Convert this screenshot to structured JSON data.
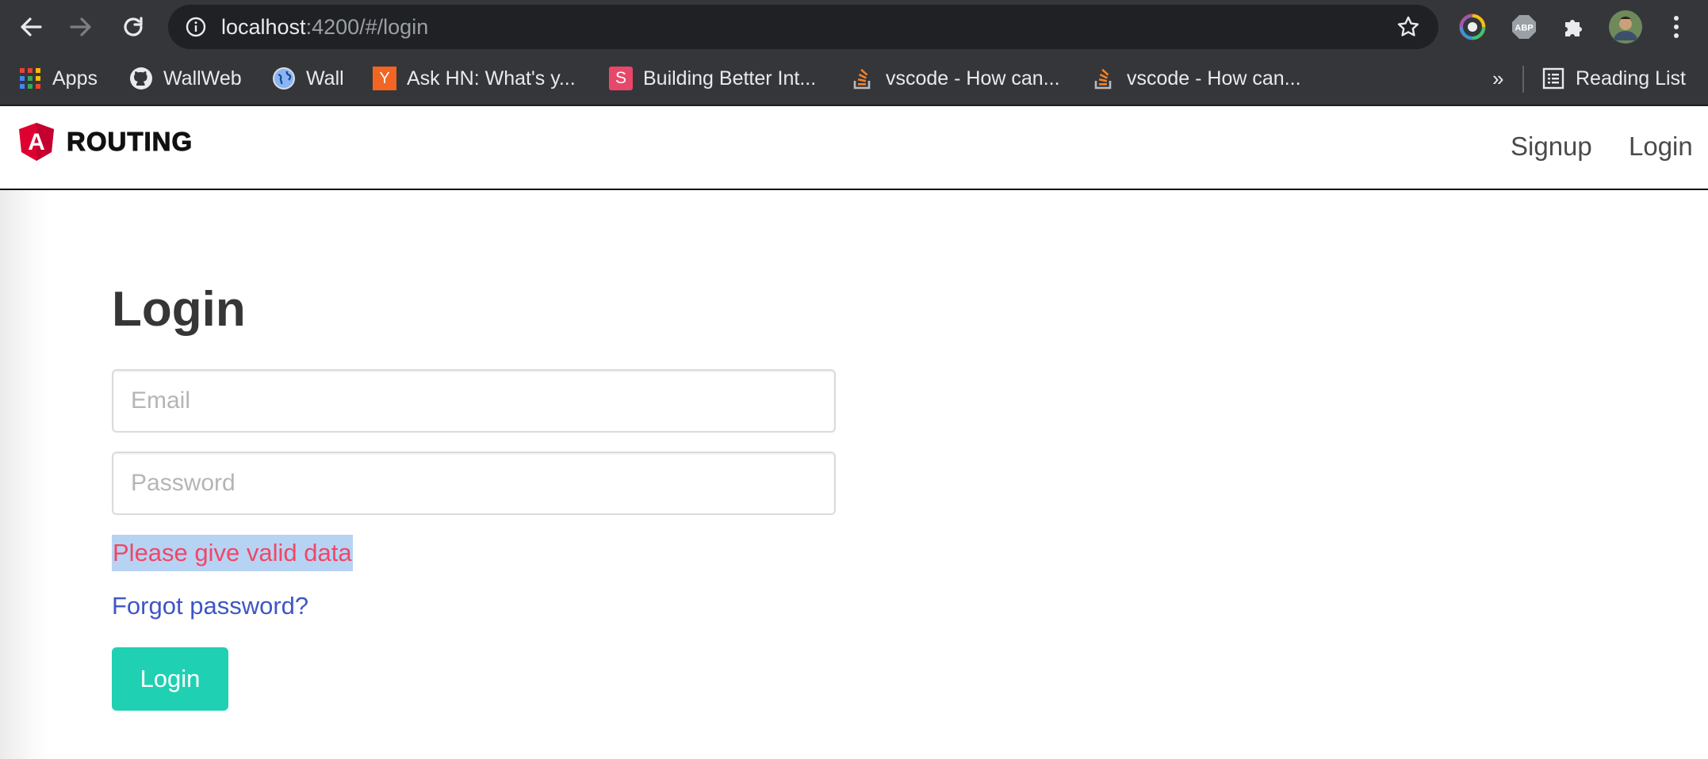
{
  "browser": {
    "url_host": "localhost",
    "url_path": ":4200/#/login",
    "bookmarks": [
      {
        "label": "Apps",
        "icon": "apps-grid-icon"
      },
      {
        "label": "WallWeb",
        "icon": "github-icon"
      },
      {
        "label": "Wall",
        "icon": "globe-icon"
      },
      {
        "label": "Ask HN: What's y...",
        "icon": "hacker-news-icon",
        "icon_text": "Y"
      },
      {
        "label": "Building Better Int...",
        "icon": "s-logo-icon",
        "icon_text": "S"
      },
      {
        "label": "vscode - How can...",
        "icon": "stackoverflow-icon"
      },
      {
        "label": "vscode - How can...",
        "icon": "stackoverflow-icon"
      }
    ],
    "overflow_label": "»",
    "reading_list_label": "Reading List",
    "extension_abp_label": "ABP"
  },
  "navbar": {
    "brand_letter": "A",
    "brand": "ROUTING",
    "links": [
      "Signup",
      "Login"
    ]
  },
  "login": {
    "title": "Login",
    "email_placeholder": "Email",
    "password_placeholder": "Password",
    "error": "Please give valid data",
    "forgot": "Forgot password?",
    "button": "Login"
  },
  "colors": {
    "chrome_bg": "#35363a",
    "omnibox_bg": "#202124",
    "angular_red": "#dd0031",
    "error": "#f14668",
    "link": "#3e56c4",
    "primary_button": "#1fd1b2"
  }
}
